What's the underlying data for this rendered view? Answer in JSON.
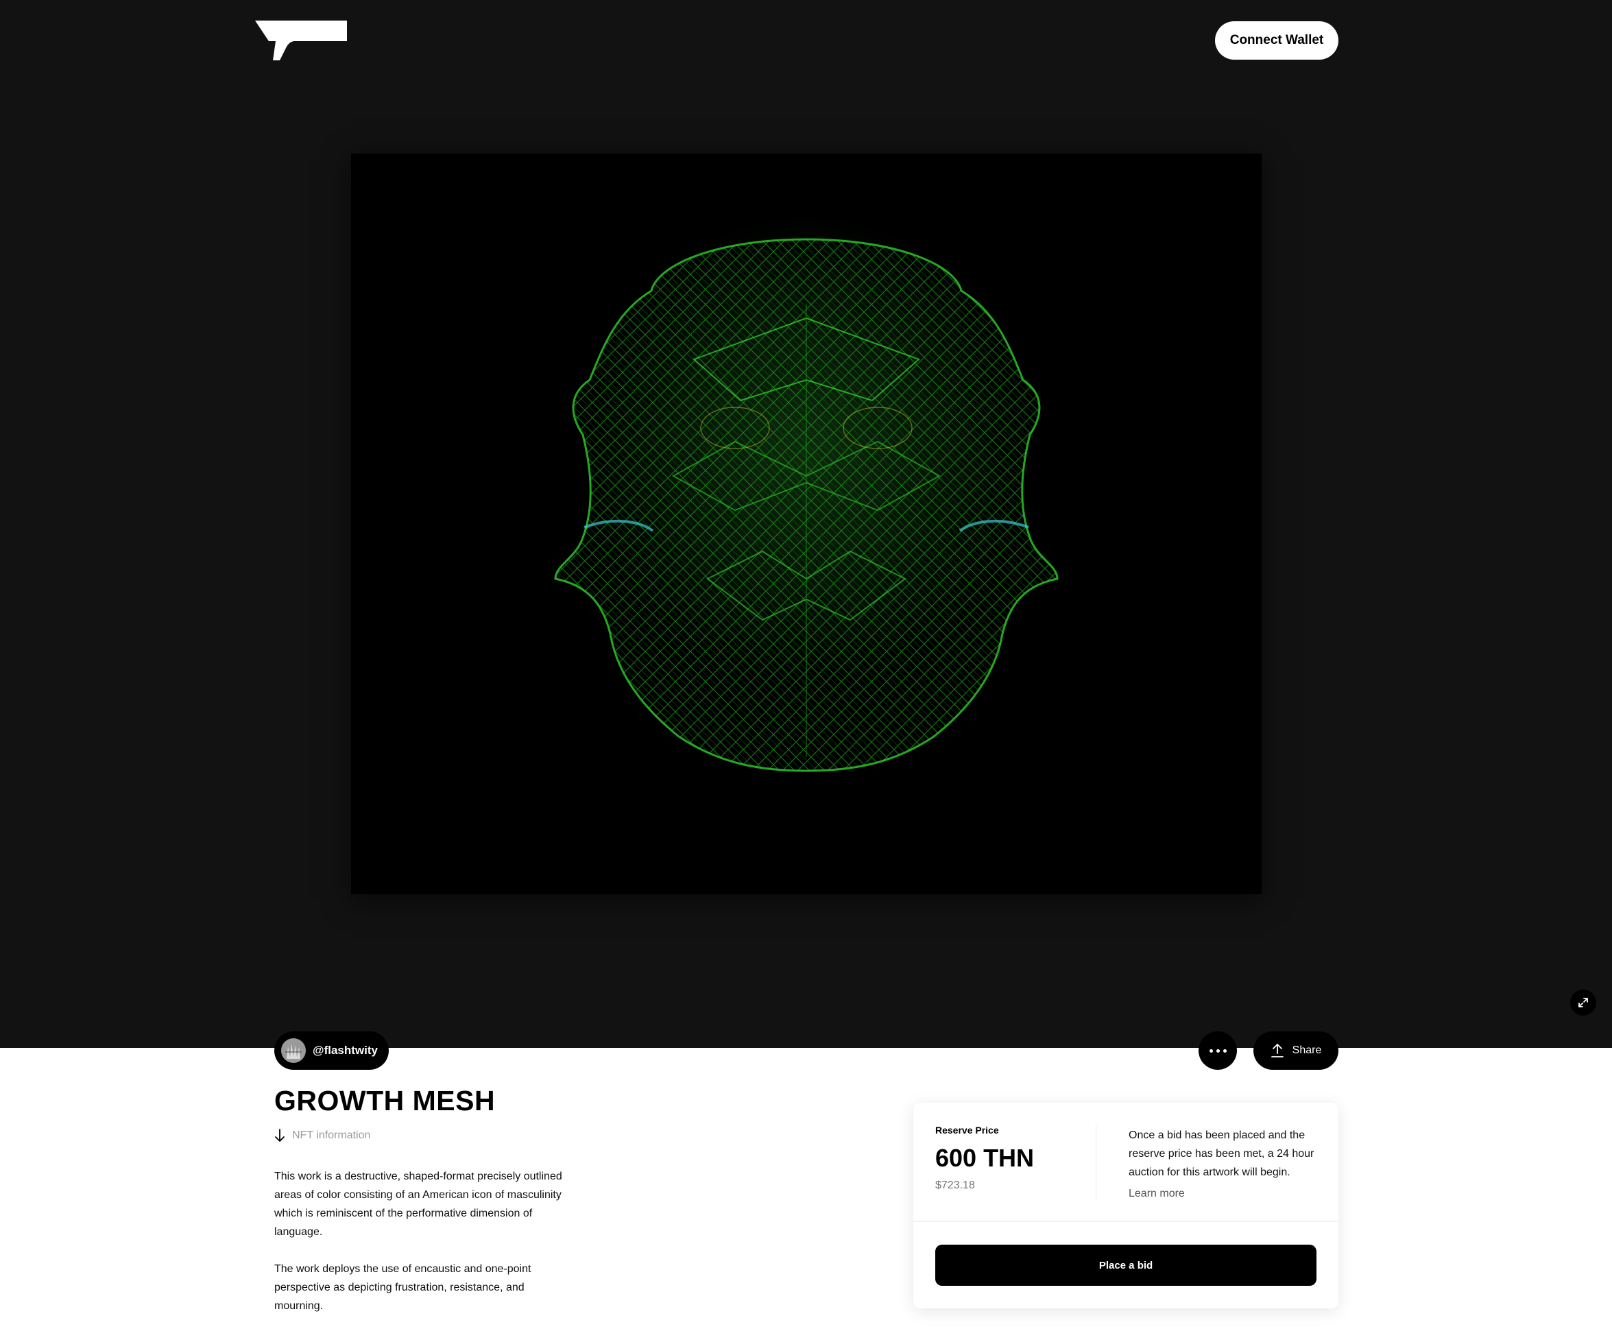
{
  "header": {
    "logo_icon": "brand-logo",
    "connect_wallet_label": "Connect Wallet"
  },
  "artwork": {
    "image_icon": "nft-artwork",
    "expand_icon": "expand-icon"
  },
  "creator": {
    "handle": "@flashtwity",
    "avatar_icon": "avatar"
  },
  "actions": {
    "more_icon": "more-icon",
    "share_label": "Share",
    "share_icon": "share-icon"
  },
  "nft": {
    "title": "GROWTH MESH",
    "info_label": "NFT information",
    "info_icon": "arrow-down-icon",
    "description": [
      "This work is a destructive, shaped-format precisely outlined areas of color consisting of an American icon of masculinity which is reminiscent of the performative dimension of language.",
      "The work deploys the use of encaustic and one-point perspective as depicting frustration, resistance, and mourning."
    ]
  },
  "bid_card": {
    "reserve_label": "Reserve Price",
    "reserve_price": "600 THN",
    "reserve_usd": "$723.18",
    "note": "Once a bid has been placed and the reserve price has been met, a 24 hour auction for this artwork will begin.",
    "learn_more": "Learn more",
    "place_bid_label": "Place a bid"
  },
  "colors": {
    "hero_bg": "#121212",
    "artwork_bg": "#000000",
    "accent_green": "#22c31e",
    "button_dark": "#000000"
  }
}
